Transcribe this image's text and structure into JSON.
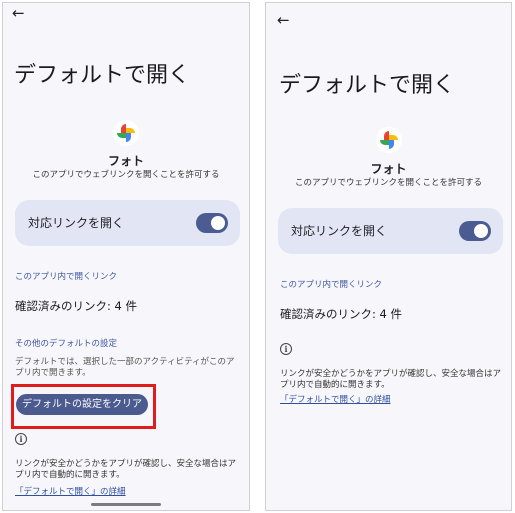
{
  "left": {
    "back_icon": "←",
    "title": "デフォルトで開く",
    "app": {
      "name": "フォト",
      "description": "このアプリでウェブリンクを開くことを許可する",
      "icon": "google-photos-pinwheel"
    },
    "toggle": {
      "label": "対応リンクを開く",
      "state": "on"
    },
    "in_app_section": "このアプリ内で開くリンク",
    "verified_links": "確認済みのリンク: 4 件",
    "other_defaults_section": "その他のデフォルトの設定",
    "other_defaults_desc": "デフォルトでは、選択した一部のアクティビティがこのアプリ内で開きます。",
    "clear_button": "デフォルトの設定をクリア",
    "info_icon": "i",
    "info_text": "リンクが安全かどうかをアプリが確認し、安全な場合はアプリ内で自動的に開きます。",
    "details_link": "「デフォルトで開く」の詳細"
  },
  "right": {
    "back_icon": "←",
    "title": "デフォルトで開く",
    "app": {
      "name": "フォト",
      "description": "このアプリでウェブリンクを開くことを許可する",
      "icon": "google-photos-pinwheel"
    },
    "toggle": {
      "label": "対応リンクを開く",
      "state": "on"
    },
    "in_app_section": "このアプリ内で開くリンク",
    "verified_links": "確認済みのリンク: 4 件",
    "info_icon": "i",
    "info_text": "リンクが安全かどうかをアプリが確認し、安全な場合はアプリ内で自動的に開きます。",
    "details_link": "「デフォルトで開く」の詳細"
  },
  "colors": {
    "accent": "#4a5c92",
    "card": "#e2e5f4",
    "section_text": "#3d55a0",
    "highlight": "#e01d1d",
    "background": "#f7f7fb"
  }
}
